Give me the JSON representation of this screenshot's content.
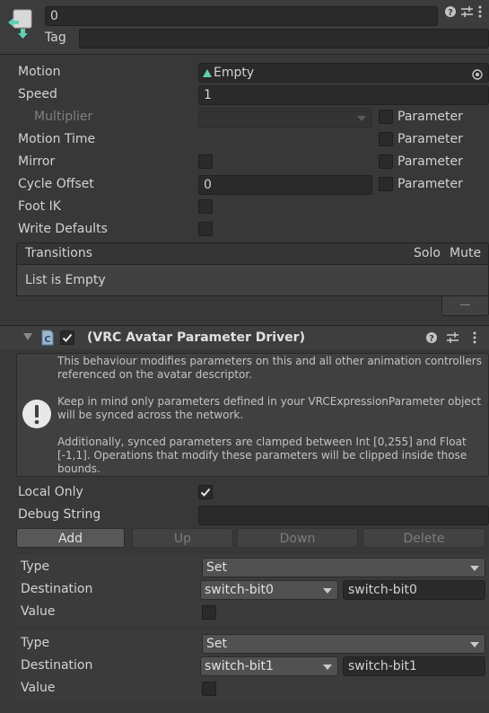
{
  "header": {
    "name_value": "0",
    "tag_label": "Tag",
    "tag_value": ""
  },
  "state": {
    "motion_label": "Motion",
    "motion_value": "Empty",
    "speed_label": "Speed",
    "speed_value": "1",
    "multiplier_label": "Multiplier",
    "motion_time_label": "Motion Time",
    "mirror_label": "Mirror",
    "cycle_offset_label": "Cycle Offset",
    "cycle_offset_value": "0",
    "foot_ik_label": "Foot IK",
    "write_defaults_label": "Write Defaults",
    "parameter_label": "Parameter"
  },
  "transitions": {
    "header": "Transitions",
    "solo": "Solo",
    "mute": "Mute",
    "empty_text": "List is Empty",
    "remove_symbol": "—"
  },
  "component": {
    "title": "(VRC Avatar Parameter Driver)",
    "enabled": true,
    "help_icon": "question-circle-icon",
    "info_p1": "This behaviour modifies parameters on this and all other animation controllers referenced on the avatar descriptor.",
    "info_p2": "Keep in mind only parameters defined in your VRCExpressionParameter object will be synced across the network.",
    "info_p3": "Additionally, synced parameters are clamped between Int [0,255] and Float [-1,1]. Operations that modify these parameters will be clipped inside those bounds.",
    "local_only_label": "Local Only",
    "local_only_checked": true,
    "debug_string_label": "Debug String",
    "debug_string_value": "",
    "add_label": "Add",
    "up_label": "Up",
    "down_label": "Down",
    "delete_label": "Delete"
  },
  "entries": [
    {
      "type_label": "Type",
      "type_value": "Set",
      "destination_label": "Destination",
      "destination_select": "switch-bit0",
      "destination_text": "switch-bit0",
      "value_label": "Value"
    },
    {
      "type_label": "Type",
      "type_value": "Set",
      "destination_label": "Destination",
      "destination_select": "switch-bit1",
      "destination_text": "switch-bit1",
      "value_label": "Value"
    }
  ],
  "colors": {
    "background": "#383838",
    "field": "#2a2a2a",
    "accent_anim": "#5fd0b3"
  }
}
